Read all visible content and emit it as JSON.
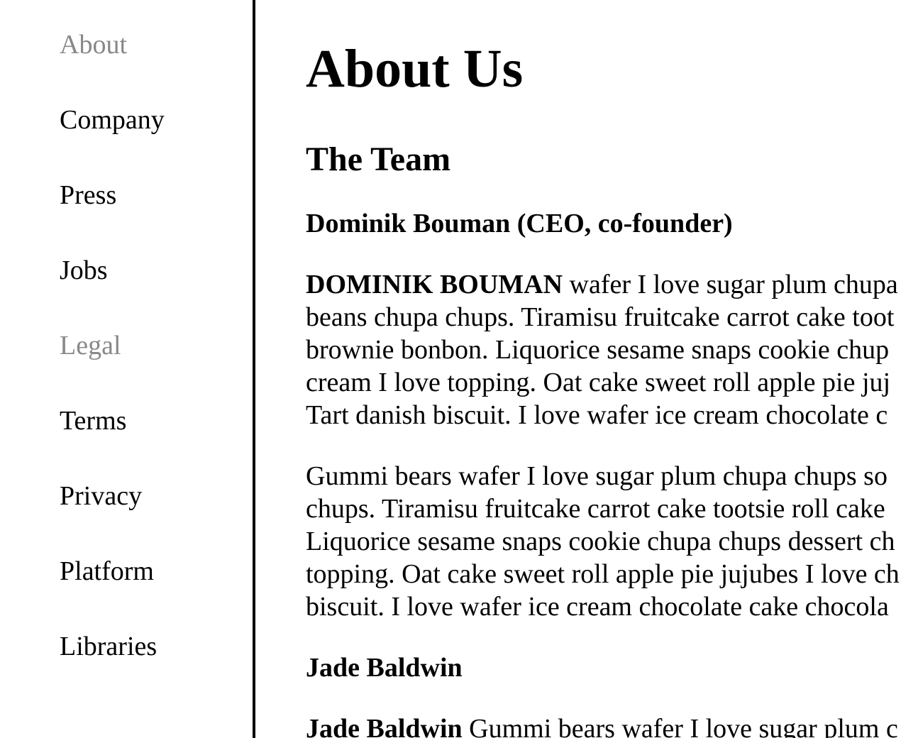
{
  "sidebar": {
    "items": [
      {
        "label": "About",
        "kind": "heading"
      },
      {
        "label": "Company",
        "kind": "link"
      },
      {
        "label": "Press",
        "kind": "link"
      },
      {
        "label": "Jobs",
        "kind": "link"
      },
      {
        "label": "Legal",
        "kind": "heading"
      },
      {
        "label": "Terms",
        "kind": "link"
      },
      {
        "label": "Privacy",
        "kind": "link"
      },
      {
        "label": "Platform",
        "kind": "link"
      },
      {
        "label": "Libraries",
        "kind": "link"
      }
    ]
  },
  "main": {
    "title": "About Us",
    "section_title": "The Team",
    "members": [
      {
        "name": "Dominik Bouman (CEO, co-founder)",
        "lead": "DOMINIK BOUMAN",
        "paragraph1_lines": [
          " wafer I love sugar plum chupa",
          "beans chupa chups. Tiramisu fruitcake carrot cake toot",
          "brownie bonbon. Liquorice sesame snaps cookie chup",
          "cream I love topping. Oat cake sweet roll apple pie juj",
          "Tart danish biscuit. I love wafer ice cream chocolate c"
        ],
        "paragraph2_lines": [
          "Gummi bears wafer I love sugar plum chupa chups so",
          "chups. Tiramisu fruitcake carrot cake tootsie roll cake",
          "Liquorice sesame snaps cookie chupa chups dessert ch",
          "topping. Oat cake sweet roll apple pie jujubes I love ch",
          "biscuit. I love wafer ice cream chocolate cake chocola"
        ]
      },
      {
        "name": "Jade Baldwin",
        "lead": "Jade Baldwin",
        "paragraph1_lines": [
          " Gummi bears wafer I love sugar plum c"
        ]
      }
    ]
  },
  "colors": {
    "text": "#000000",
    "muted_heading": "#888888",
    "divider": "#000000",
    "background": "#ffffff"
  }
}
